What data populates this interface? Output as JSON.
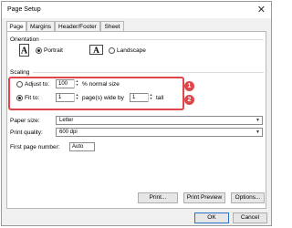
{
  "window": {
    "title": "Page Setup",
    "close_glyph": "✕"
  },
  "tabs": [
    {
      "label": "Page",
      "active": true
    },
    {
      "label": "Margins",
      "active": false
    },
    {
      "label": "Header/Footer",
      "active": false
    },
    {
      "label": "Sheet",
      "active": false
    }
  ],
  "orientation": {
    "label": "Orientation",
    "portrait": {
      "label": "Portrait",
      "selected": true
    },
    "landscape": {
      "label": "Landscape",
      "selected": false
    }
  },
  "scaling": {
    "label": "Scaling",
    "adjust_to": {
      "label": "Adjust to:",
      "value": "100",
      "suffix": "% normal size",
      "selected": false
    },
    "fit_to": {
      "label": "Fit to:",
      "wide_value": "1",
      "wide_suffix": "page(s) wide by",
      "tall_value": "1",
      "tall_suffix": "tall",
      "selected": true
    }
  },
  "paper_size": {
    "label": "Paper size:",
    "value": "Letter"
  },
  "print_quality": {
    "label": "Print quality:",
    "value": "600 dpi"
  },
  "first_page_number": {
    "label": "First page number:",
    "value": "Auto"
  },
  "buttons": {
    "print": "Print...",
    "print_preview": "Print Preview",
    "options": "Options...",
    "ok": "OK",
    "cancel": "Cancel"
  },
  "annotations": {
    "badge1": "1",
    "badge2": "2",
    "highlight_color": "#e0454b"
  },
  "icons": {
    "portrait_letter": "A",
    "landscape_letter": "A"
  }
}
